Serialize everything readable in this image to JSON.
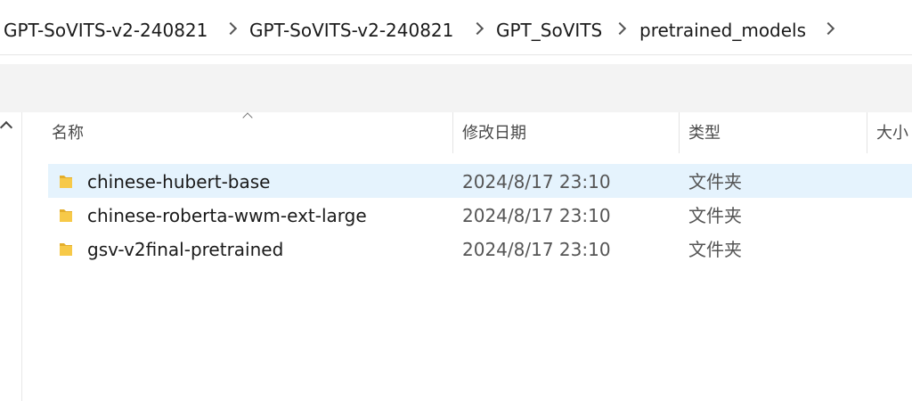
{
  "breadcrumb": {
    "items": [
      {
        "label": "GPT-SoVITS-v2-240821"
      },
      {
        "label": "GPT-SoVITS-v2-240821"
      },
      {
        "label": "GPT_SoVITS"
      },
      {
        "label": "pretrained_models"
      }
    ]
  },
  "columns": {
    "name": "名称",
    "date": "修改日期",
    "type": "类型",
    "size": "大小"
  },
  "files": [
    {
      "name": "chinese-hubert-base",
      "date": "2024/8/17 23:10",
      "type": "文件夹",
      "icon": "folder-icon",
      "selected": true
    },
    {
      "name": "chinese-roberta-wwm-ext-large",
      "date": "2024/8/17 23:10",
      "type": "文件夹",
      "icon": "folder-icon",
      "selected": false
    },
    {
      "name": "gsv-v2final-pretrained",
      "date": "2024/8/17 23:10",
      "type": "文件夹",
      "icon": "folder-icon",
      "selected": false
    }
  ],
  "colors": {
    "selection": "#e5f3fd",
    "folder": "#f7c948",
    "folder_dark": "#e4ae2b",
    "commandbar": "#f3f3f3"
  }
}
